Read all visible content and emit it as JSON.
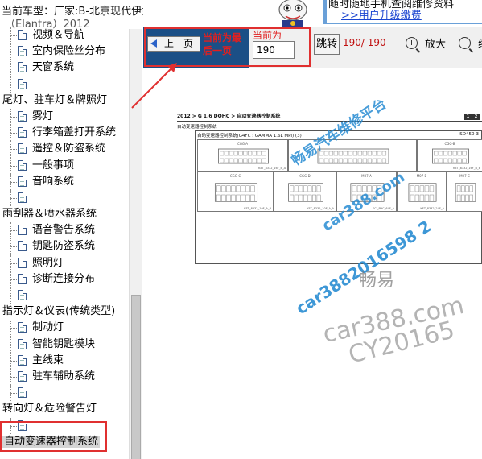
{
  "vehicle": {
    "label": "当前车型：",
    "value": "厂家:B-北京现代伊兰特悦动",
    "line2": "（Elantra）2012"
  },
  "banner": {
    "text": "随时随地手机查阅维修资料",
    "link": ">>用户升级缴费"
  },
  "toolbar": {
    "prev_label": "上一页",
    "annotation": "当前为最后一页",
    "current_label": "当前为",
    "page_value": "190",
    "jump_label": "跳转",
    "page_count": "190/ 190",
    "zoom_in_label": "放大",
    "zoom_out_label": "缩"
  },
  "tree": [
    {
      "label": "视频＆导航",
      "level": 1
    },
    {
      "label": "室内保险丝分布",
      "level": 1
    },
    {
      "label": "天窗系统",
      "level": 1
    },
    {
      "label": "",
      "level": 1
    },
    {
      "label": "尾灯、驻车灯＆牌照灯",
      "level": 0
    },
    {
      "label": "雾灯",
      "level": 1
    },
    {
      "label": "行李箱盖打开系统",
      "level": 1
    },
    {
      "label": "遥控＆防盗系统",
      "level": 1
    },
    {
      "label": "一般事项",
      "level": 1
    },
    {
      "label": "音响系统",
      "level": 1
    },
    {
      "label": "",
      "level": 1
    },
    {
      "label": "雨刮器＆喷水器系统",
      "level": 0
    },
    {
      "label": "语音警告系统",
      "level": 1
    },
    {
      "label": "钥匙防盗系统",
      "level": 1
    },
    {
      "label": "照明灯",
      "level": 1
    },
    {
      "label": "诊断连接分布",
      "level": 1
    },
    {
      "label": "",
      "level": 1
    },
    {
      "label": "指示灯＆仪表(传统类型)",
      "level": 0
    },
    {
      "label": "制动灯",
      "level": 1
    },
    {
      "label": "智能钥匙模块",
      "level": 1
    },
    {
      "label": "主线束",
      "level": 1
    },
    {
      "label": "驻车辅助系统",
      "level": 1
    },
    {
      "label": "",
      "level": 1
    },
    {
      "label": "转向灯＆危险警告灯",
      "level": 0
    },
    {
      "label": "",
      "level": 1
    },
    {
      "label": "自动变速器控制系统",
      "level": 0,
      "selected": true
    }
  ],
  "document": {
    "header": "2012 > G 1.6 DOHC > 自动变速器控制系统",
    "page_tags": [
      "1",
      "2"
    ],
    "subtitle": "自动变速器控制系统",
    "frame_title": "自动变速器控制系统(G4FC : GAMMA 1.6L MPI) (3)",
    "frame_code": "SD450-3",
    "connectors": [
      {
        "tag": "CGG-A",
        "foot": "KET_8332_16F_B_A"
      },
      {
        "tag": "",
        "foot": ""
      },
      {
        "tag": "CGG-B",
        "foot": "KET_8332_16F_B_B"
      },
      {
        "tag": "CGG-C",
        "foot": "KET_8332_10F_A_B"
      },
      {
        "tag": "CGG-D",
        "foot": "KET_8332_10F_A_A"
      },
      {
        "tag": "M07-A",
        "foot": "FCI_PHC_64F_A"
      },
      {
        "tag": "M07-B",
        "foot": "KET_8332_24F_A"
      },
      {
        "tag": "M07-C",
        "foot": ""
      }
    ]
  },
  "watermarks": {
    "w1": "畅易汽车维修平台",
    "w2": "car388.com",
    "w3": "car388.com",
    "w4": "car3882016598 2",
    "w5": "畅易",
    "w6": "car388.com",
    "w7": "CY20165"
  },
  "colors": {
    "toolbar_blue": "#1b4f86",
    "annotation_red": "#e02020",
    "link_blue": "#1a44d0",
    "watermark_blue": "#288cd2"
  }
}
